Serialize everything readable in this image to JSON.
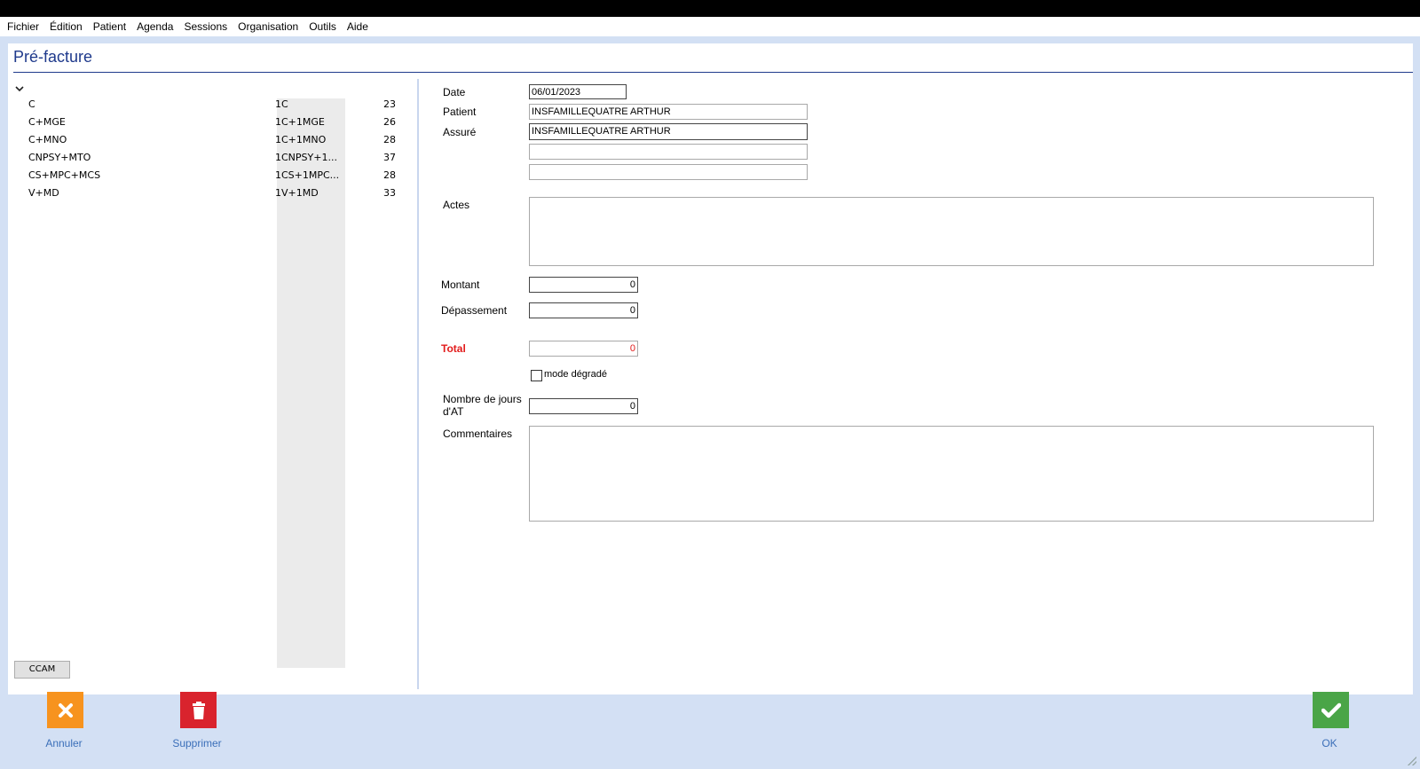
{
  "menu": [
    "Fichier",
    "Édition",
    "Patient",
    "Agenda",
    "Sessions",
    "Organisation",
    "Outils",
    "Aide"
  ],
  "window_title": "Pré-facture",
  "acts_list": [
    {
      "code": "C",
      "label": "1C",
      "amount": "23"
    },
    {
      "code": "C+MGE",
      "label": "1C+1MGE",
      "amount": "26"
    },
    {
      "code": "C+MNO",
      "label": "1C+1MNO",
      "amount": "28"
    },
    {
      "code": "CNPSY+MTO",
      "label": "1CNPSY+1...",
      "amount": "37"
    },
    {
      "code": "CS+MPC+MCS",
      "label": "1CS+1MPC...",
      "amount": "28"
    },
    {
      "code": "V+MD",
      "label": "1V+1MD",
      "amount": "33"
    }
  ],
  "ccam_button": "CCAM",
  "form": {
    "date_label": "Date",
    "date_value": "06/01/2023",
    "patient_label": "Patient",
    "patient_value": "INSFAMILLEQUATRE ARTHUR",
    "assure_label": "Assuré",
    "assure_value": "INSFAMILLEQUATRE ARTHUR",
    "actes_label": "Actes",
    "montant_label": "Montant",
    "montant_value": "0",
    "depassement_label": "Dépassement",
    "depassement_value": "0",
    "total_label": "Total",
    "total_value": "0",
    "mode_degrade_label": "mode dégradé",
    "jours_at_label_1": "Nombre de jours",
    "jours_at_label_2": "d'AT",
    "jours_at_value": "0",
    "commentaires_label": "Commentaires"
  },
  "buttons": {
    "annuler": "Annuler",
    "supprimer": "Supprimer",
    "ok": "OK"
  },
  "colors": {
    "annuler": "#f7931e",
    "supprimer": "#d9232d",
    "ok": "#4aa547",
    "title": "#1f3a8c",
    "total": "#e21b1b"
  }
}
